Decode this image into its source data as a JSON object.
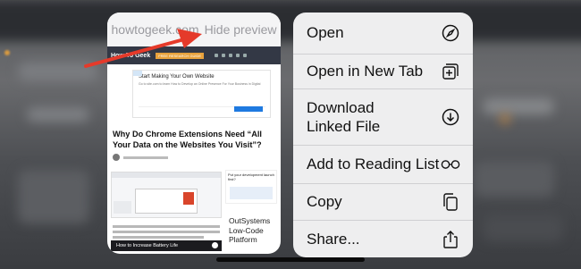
{
  "preview": {
    "domain": "howtogeek.com",
    "hide_label": "Hide preview",
    "site_logo": "How-To Geek",
    "site_badge": "FREE RESEARCH GUIDE",
    "ad_title": "Start Making Your Own Website",
    "ad_subtitle": "Go to site.com to learn How to Develop an Online Presence For Your Business in Digital",
    "article_title": "Why Do Chrome Extensions Need “All Your Data on the Websites You Visit”?",
    "side_ad_title": "Put your development launch first?",
    "promo_text": "OutSystems Low-Code Platform",
    "bottom_bar_text": "How to Increase Battery Life"
  },
  "menu": {
    "items": [
      {
        "label": "Open",
        "icon": "compass-icon"
      },
      {
        "label": "Open in New Tab",
        "icon": "new-tab-icon"
      },
      {
        "label": "Download Linked File",
        "icon": "download-circle-icon"
      },
      {
        "label": "Add to Reading List",
        "icon": "glasses-icon"
      },
      {
        "label": "Copy",
        "icon": "copy-icon"
      },
      {
        "label": "Share...",
        "icon": "share-icon"
      }
    ]
  },
  "colors": {
    "arrow": "#e53a2a",
    "menu_bg": "#eeeeef",
    "site_bar": "#333845"
  }
}
